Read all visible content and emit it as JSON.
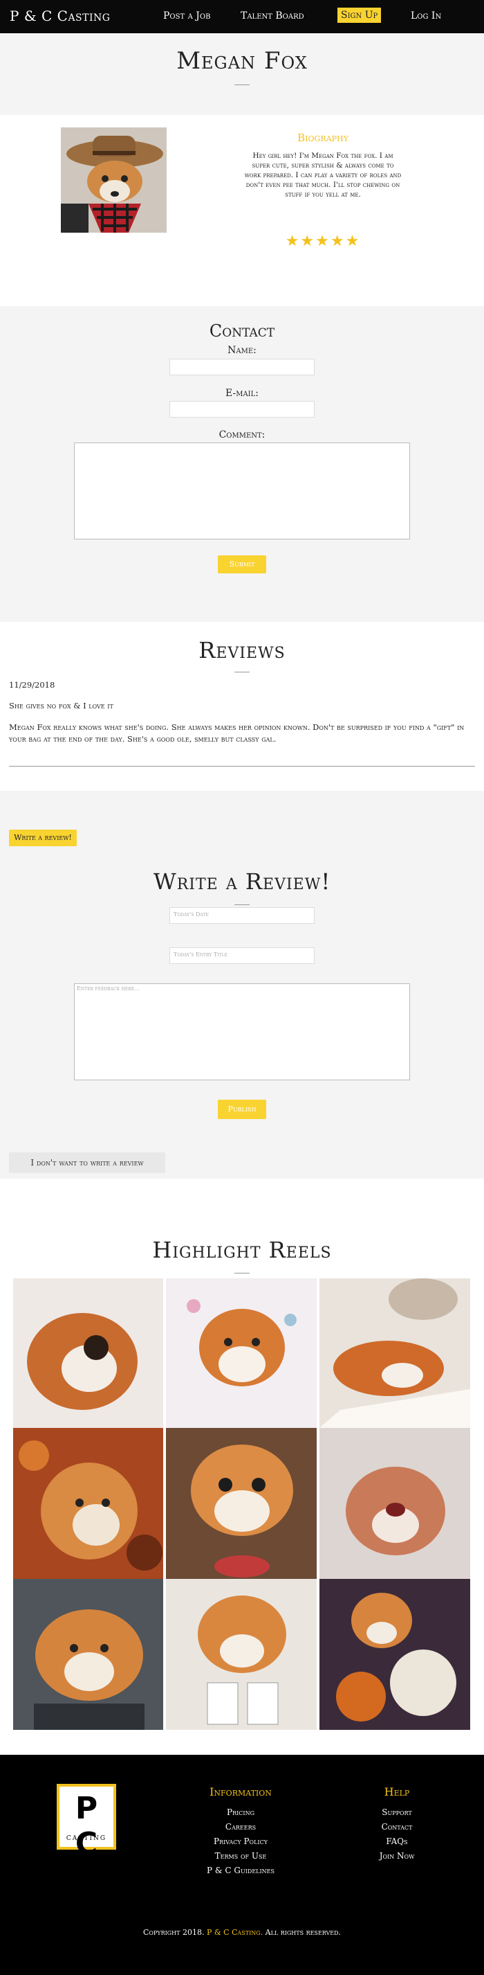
{
  "nav": {
    "brand": "P & C Casting",
    "links": [
      "Post a Job",
      "Talent Board",
      "Sign Up",
      "Log In"
    ]
  },
  "profile": {
    "name": "Megan Fox",
    "bio_title": "Biography",
    "bio_text": "Hey girl hey! I'm Megan Fox the fox. I am super cute, super stylish & always come to work prepared. I can play a variety of roles and don't even pee that much. I'll stop chewing on stuff if you yell at me.",
    "stars": "★★★★★",
    "rating": 5
  },
  "contact": {
    "title": "Contact",
    "name_label": "Name:",
    "email_label": "E-mail:",
    "comment_label": "Comment:",
    "submit": "Submit"
  },
  "reviews": {
    "title": "Reviews",
    "items": [
      {
        "date": "11/29/2018",
        "title": "She gives no fox & I love it",
        "body": "Megan Fox really knows what she's doing. She always makes her opinion known. Don't be surprised if you find a \"gift\" in your bag at the end of the day. She's a good ole, smelly but classy gal."
      }
    ]
  },
  "write": {
    "toggle_button": "Write a review!",
    "title": "Write a Review!",
    "date_placeholder": "Today's Date",
    "title_placeholder": "Today's Entry Title",
    "body_placeholder": "Enter feedback here...",
    "publish": "Publish",
    "cancel": "I don't want to write a review"
  },
  "highlights": {
    "title": "Highlight Reels"
  },
  "footer": {
    "logo_text": "P C",
    "logo_sub": "CASTING",
    "info_title": "Information",
    "info_links": [
      "Pricing",
      "Careers",
      "Privacy Policy",
      "Terms of Use",
      "P & C Guidelines"
    ],
    "help_title": "Help",
    "help_links": [
      "Support",
      "Contact",
      "FAQs",
      "Join Now"
    ],
    "copyright_prefix": "Copyright 2018.",
    "copyright_brand": "P & C Casting.",
    "copyright_suffix": "All rights reserved."
  },
  "colors": {
    "accent": "#f9d330",
    "nav_bg": "#0a0a0a",
    "section_gray": "#f4f4f4"
  }
}
